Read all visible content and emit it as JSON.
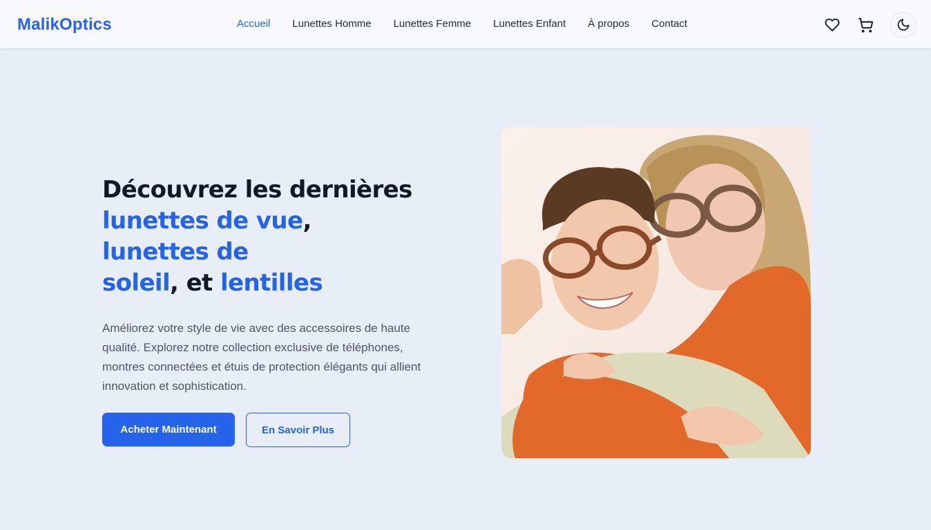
{
  "brand": {
    "name": "MalikOptics",
    "color": "#2563eb"
  },
  "nav": {
    "items": [
      {
        "label": "Accueil",
        "active": true
      },
      {
        "label": "Lunettes Homme",
        "active": false
      },
      {
        "label": "Lunettes Femme",
        "active": false
      },
      {
        "label": "Lunettes Enfant",
        "active": false
      },
      {
        "label": "À propos",
        "active": false
      },
      {
        "label": "Contact",
        "active": false
      }
    ]
  },
  "header_icons": [
    "heart-icon",
    "cart-icon",
    "moon-icon"
  ],
  "hero": {
    "headline": {
      "line1": "Découvrez les dernières",
      "hl1": "lunettes de vue",
      "comma1": ",",
      "hl2": "lunettes de soleil",
      "connector": ", et ",
      "hl3": "lentilles"
    },
    "description": "Améliorez votre style de vie avec des accessoires de haute qualité. Explorez notre collection exclusive de téléphones, montres connectées et étuis de protection élégants qui allient innovation et sophistication.",
    "primary_button": "Acheter Maintenant",
    "secondary_button": "En Savoir Plus"
  },
  "colors": {
    "accent": "#2563eb",
    "background": "#e8eef7",
    "header_bg": "#f7f9fc",
    "heading": "#111827",
    "body_text": "#4b5563"
  }
}
